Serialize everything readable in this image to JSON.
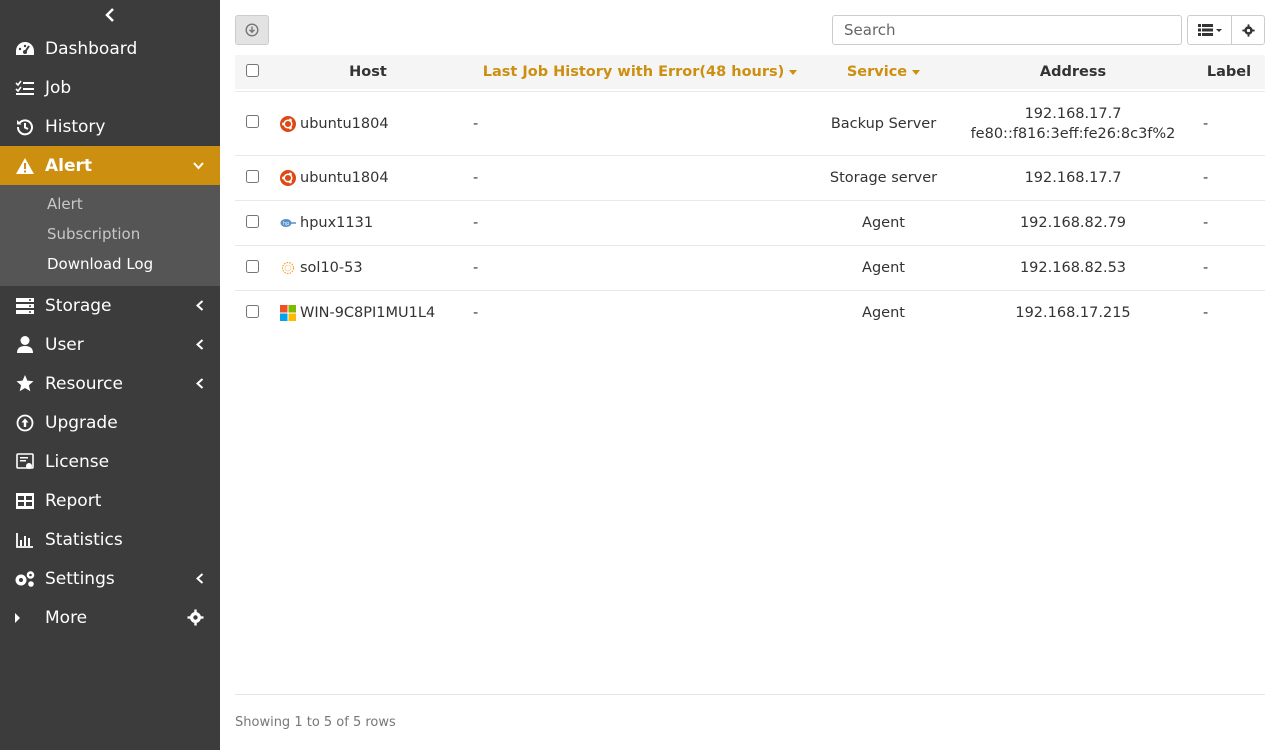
{
  "sidebar": {
    "collapse_icon": "chevron-left-icon",
    "items": [
      {
        "label": "Dashboard",
        "icon": "dashboard-icon"
      },
      {
        "label": "Job",
        "icon": "list-icon"
      },
      {
        "label": "History",
        "icon": "history-icon"
      },
      {
        "label": "Alert",
        "icon": "warning-icon",
        "active": true,
        "expanded": true,
        "sub_items": [
          "Alert",
          "Subscription",
          "Download Log"
        ]
      },
      {
        "label": "Storage",
        "icon": "server-icon",
        "has_children": true
      },
      {
        "label": "User",
        "icon": "user-icon",
        "has_children": true
      },
      {
        "label": "Resource",
        "icon": "star-icon",
        "has_children": true
      },
      {
        "label": "Upgrade",
        "icon": "upgrade-icon"
      },
      {
        "label": "License",
        "icon": "license-icon"
      },
      {
        "label": "Report",
        "icon": "table-icon"
      },
      {
        "label": "Statistics",
        "icon": "bar-chart-icon"
      },
      {
        "label": "Settings",
        "icon": "gears-icon",
        "has_children": true
      },
      {
        "label": "More",
        "icon": "caret-right-icon"
      }
    ],
    "active_color": "#cc8f0f",
    "background_color": "#3c3c3c"
  },
  "toolbar": {
    "search_placeholder": "Search",
    "export_icon": "download-circle-icon",
    "columns_icon": "list-view-icon",
    "settings_icon": "gear-icon"
  },
  "table": {
    "columns": [
      "Host",
      "Last Job History with Error(48 hours)",
      "Service",
      "Address",
      "Label"
    ],
    "sortable_columns": [
      "Last Job History with Error(48 hours)",
      "Service"
    ],
    "rows": [
      {
        "os": "ubuntu",
        "host": "ubuntu1804",
        "job": "-",
        "service": "Backup Server",
        "address": [
          "192.168.17.7",
          "fe80::f816:3eff:fe26:8c3f%2"
        ],
        "label": "-"
      },
      {
        "os": "ubuntu",
        "host": "ubuntu1804",
        "job": "-",
        "service": "Storage server",
        "address": [
          "192.168.17.7"
        ],
        "label": "-"
      },
      {
        "os": "hpux",
        "host": "hpux1131",
        "job": "-",
        "service": "Agent",
        "address": [
          "192.168.82.79"
        ],
        "label": "-"
      },
      {
        "os": "solaris",
        "host": "sol10-53",
        "job": "-",
        "service": "Agent",
        "address": [
          "192.168.82.53"
        ],
        "label": "-"
      },
      {
        "os": "windows",
        "host": "WIN-9C8PI1MU1L4",
        "job": "-",
        "service": "Agent",
        "address": [
          "192.168.17.215"
        ],
        "label": "-"
      }
    ]
  },
  "footer": {
    "pagination_info": "Showing 1 to 5 of 5 rows"
  }
}
